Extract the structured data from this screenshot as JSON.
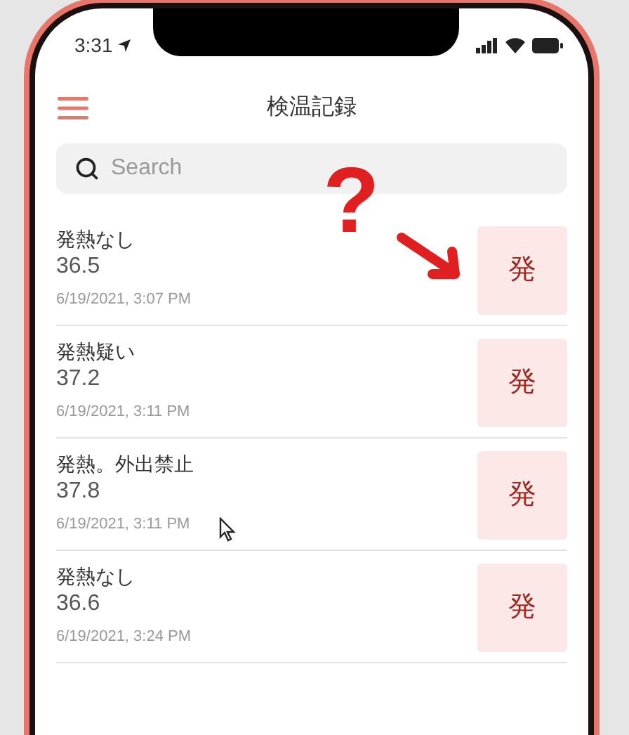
{
  "status_bar": {
    "time": "3:31"
  },
  "header": {
    "title": "検温記録"
  },
  "search": {
    "placeholder": "Search"
  },
  "records": [
    {
      "note": "発熱なし",
      "temperature": "36.5",
      "timestamp": "6/19/2021, 3:07 PM",
      "badge": "発"
    },
    {
      "note": "発熱疑い",
      "temperature": "37.2",
      "timestamp": "6/19/2021, 3:11 PM",
      "badge": "発"
    },
    {
      "note": "発熱。外出禁止",
      "temperature": "37.8",
      "timestamp": "6/19/2021, 3:11 PM",
      "badge": "発"
    },
    {
      "note": "発熱なし",
      "temperature": "36.6",
      "timestamp": "6/19/2021, 3:24 PM",
      "badge": "発"
    }
  ],
  "annotation": {
    "mark": "?"
  }
}
